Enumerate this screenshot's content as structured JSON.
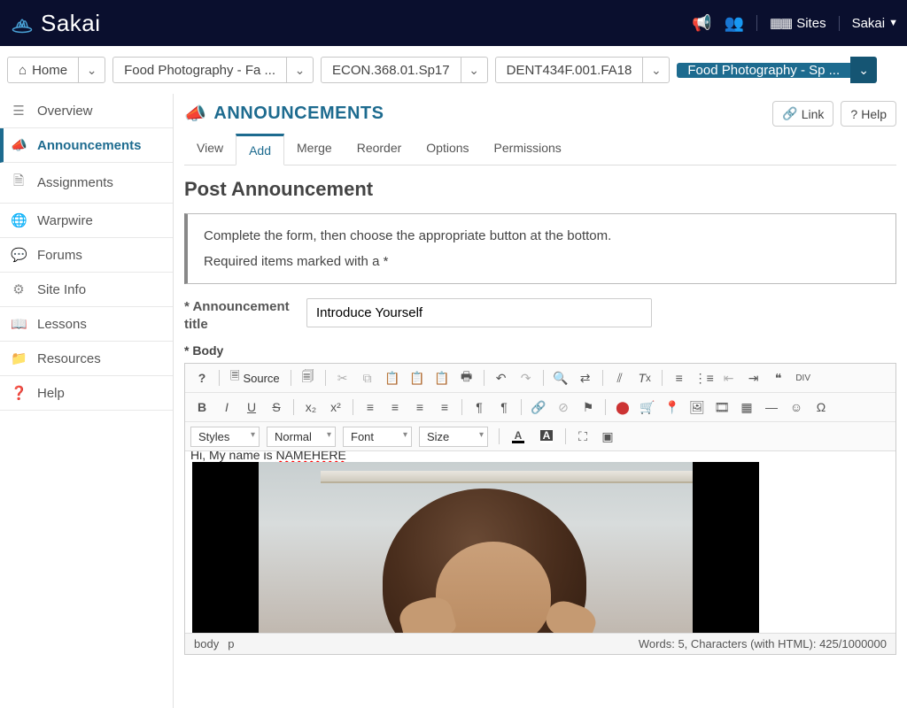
{
  "topbar": {
    "logo_text": "Sakai",
    "sites_label": "Sites",
    "user_label": "Sakai"
  },
  "site_tabs": [
    {
      "label": "Home",
      "has_home_icon": true
    },
    {
      "label": "Food Photography - Fa ..."
    },
    {
      "label": "ECON.368.01.Sp17"
    },
    {
      "label": "DENT434F.001.FA18"
    },
    {
      "label": "Food Photography - Sp ...",
      "active": true
    }
  ],
  "sidebar": [
    {
      "icon": "list",
      "label": "Overview"
    },
    {
      "icon": "bullhorn",
      "label": "Announcements",
      "active": true
    },
    {
      "icon": "file",
      "label": "Assignments"
    },
    {
      "icon": "globe",
      "label": "Warpwire"
    },
    {
      "icon": "comments",
      "label": "Forums"
    },
    {
      "icon": "gear",
      "label": "Site Info"
    },
    {
      "icon": "book",
      "label": "Lessons"
    },
    {
      "icon": "folder",
      "label": "Resources"
    },
    {
      "icon": "question",
      "label": "Help"
    }
  ],
  "tool": {
    "title": "ANNOUNCEMENTS",
    "link_label": "Link",
    "help_label": "Help"
  },
  "tool_tabs": [
    "View",
    "Add",
    "Merge",
    "Reorder",
    "Options",
    "Permissions"
  ],
  "tool_tab_active": "Add",
  "page_heading": "Post Announcement",
  "info": {
    "line1": "Complete the form, then choose the appropriate button at the bottom.",
    "line2": "Required items marked with a *"
  },
  "form": {
    "title_label": "* Announcement title",
    "title_value": "Introduce Yourself",
    "body_label": "* Body"
  },
  "editor": {
    "source_label": "Source",
    "styles_label": "Styles",
    "format_label": "Normal",
    "font_label": "Font",
    "size_label": "Size",
    "body_text_prefix": "Hi, My name is ",
    "body_text_name": "NAMEHERE",
    "footer_path": [
      "body",
      "p"
    ],
    "footer_stats": "Words: 5, Characters (with HTML): 425/1000000"
  }
}
